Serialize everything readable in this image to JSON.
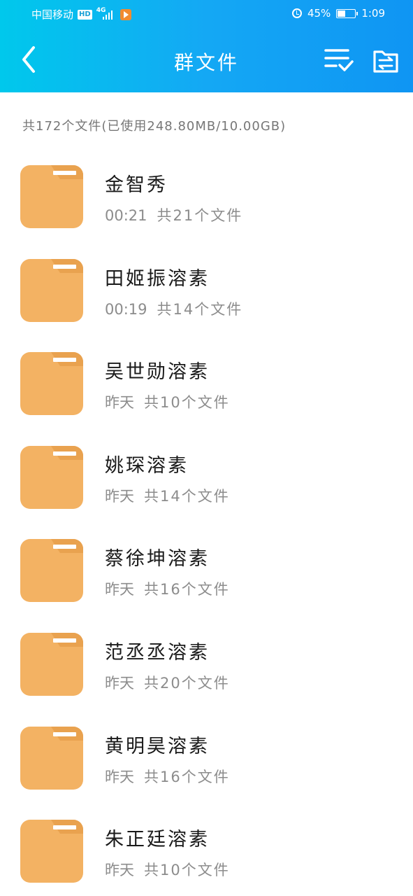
{
  "status_bar": {
    "carrier": "中国移动",
    "hd_label": "HD",
    "network_label": "4G",
    "battery_text": "45%",
    "battery_level": 0.45,
    "time": "1:09"
  },
  "header": {
    "title": "群文件"
  },
  "summary": "共172个文件(已使用248.80MB/10.00GB)",
  "colors": {
    "header_gradient_start": "#00c8ec",
    "header_gradient_end": "#0f95f3",
    "folder": "#f3b263",
    "folder_tab": "#e9a24f"
  },
  "files": [
    {
      "name": "金智秀",
      "time": "00:21",
      "count": "共21个文件"
    },
    {
      "name": "田姬振溶素",
      "time": "00:19",
      "count": "共14个文件"
    },
    {
      "name": "吴世勋溶素",
      "time": "昨天",
      "count": "共10个文件"
    },
    {
      "name": "姚琛溶素",
      "time": "昨天",
      "count": "共14个文件"
    },
    {
      "name": "蔡徐坤溶素",
      "time": "昨天",
      "count": "共16个文件"
    },
    {
      "name": "范丞丞溶素",
      "time": "昨天",
      "count": "共20个文件"
    },
    {
      "name": "黄明昊溶素",
      "time": "昨天",
      "count": "共16个文件"
    },
    {
      "name": "朱正廷溶素",
      "time": "昨天",
      "count": "共10个文件"
    }
  ]
}
